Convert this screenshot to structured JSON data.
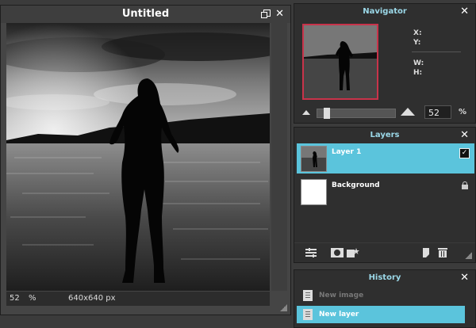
{
  "document": {
    "title": "Untitled",
    "zoom": "52",
    "zoom_unit": "%",
    "size": "640x640 px"
  },
  "navigator": {
    "title": "Navigator",
    "x_label": "X:",
    "y_label": "Y:",
    "w_label": "W:",
    "h_label": "H:",
    "zoom": "52",
    "zoom_unit": "%"
  },
  "layers": {
    "title": "Layers",
    "items": [
      {
        "name": "Layer 1",
        "selected": true,
        "visible_check": "✓"
      },
      {
        "name": "Background",
        "selected": false,
        "locked": true
      }
    ]
  },
  "history": {
    "title": "History",
    "items": [
      {
        "label": "New image",
        "selected": false
      },
      {
        "label": "New layer",
        "selected": true
      }
    ]
  },
  "colors": {
    "accent": "#5bc4dc",
    "nav_frame": "#c8334a"
  }
}
